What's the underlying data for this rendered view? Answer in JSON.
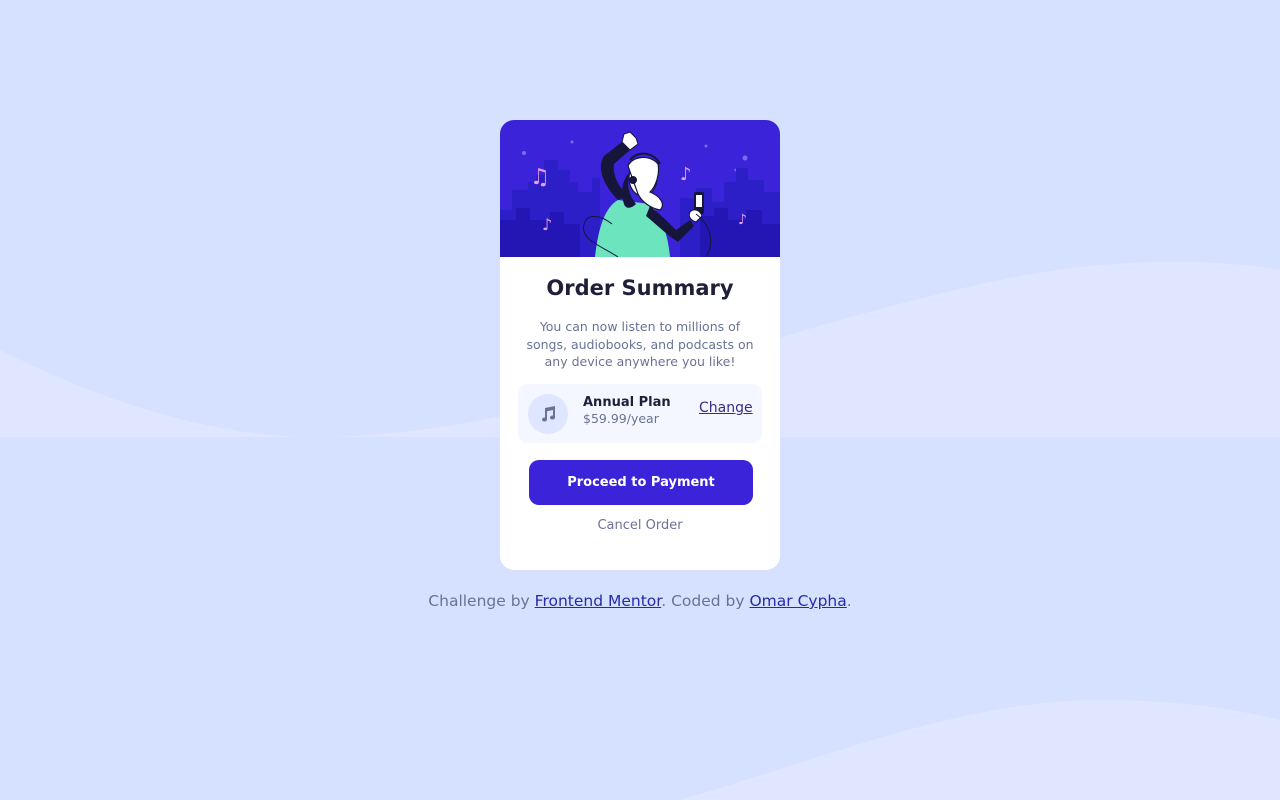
{
  "colors": {
    "page_background": "#d6e1ff",
    "wave_light": "#e0e6ff",
    "card_background": "#ffffff",
    "hero_background": "#3b23d9",
    "primary_button": "#3b23d9",
    "muted_text": "#6a7396",
    "heading_text": "#1f1f3a",
    "link_text": "#2a2aa8"
  },
  "card": {
    "title": "Order Summary",
    "description": "You can now listen to millions of songs, audiobooks, and podcasts on any device anywhere you like!",
    "plan": {
      "icon": "music-note-icon",
      "name": "Annual Plan",
      "price": "$59.99/year",
      "change_label": "Change"
    },
    "proceed_label": "Proceed to Payment",
    "cancel_label": "Cancel Order"
  },
  "footer": {
    "prefix": "Challenge by ",
    "challenge_link": "Frontend Mentor",
    "middle": ". Coded by ",
    "author_link": "Omar Cypha",
    "suffix": "."
  }
}
